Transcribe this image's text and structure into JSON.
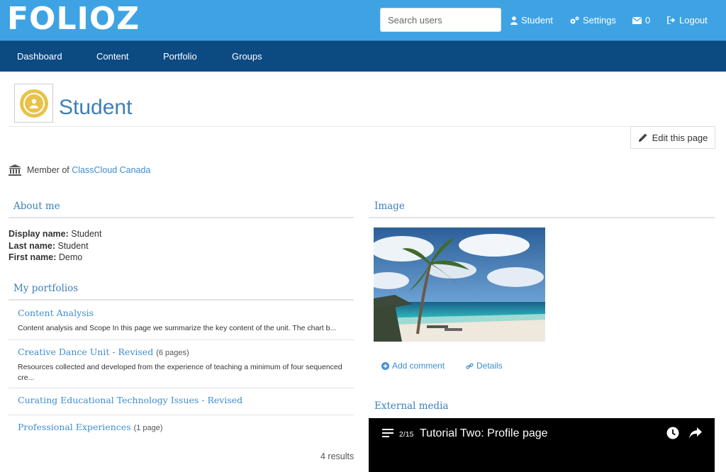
{
  "header": {
    "logo": "FOLIOZ",
    "search_placeholder": "Search users",
    "user_label": "Student",
    "settings_label": "Settings",
    "messages_count": "0",
    "logout_label": "Logout"
  },
  "nav": {
    "items": [
      {
        "label": "Dashboard"
      },
      {
        "label": "Content"
      },
      {
        "label": "Portfolio"
      },
      {
        "label": "Groups"
      }
    ]
  },
  "page": {
    "title": "Student",
    "edit_label": "Edit this page",
    "member_prefix": "Member of",
    "member_institution": "ClassCloud Canada"
  },
  "about": {
    "title": "About me",
    "fields": [
      {
        "label": "Display name:",
        "value": "Student"
      },
      {
        "label": "Last name:",
        "value": "Student"
      },
      {
        "label": "First name:",
        "value": "Demo"
      }
    ]
  },
  "portfolios": {
    "title": "My portfolios",
    "items": [
      {
        "title": "Content Analysis",
        "pages": "",
        "desc": "Content analysis and Scope In this page we summarize the key content of the unit.  The chart b..."
      },
      {
        "title": "Creative Dance Unit - Revised",
        "pages": "(6 pages)",
        "desc": "Resources collected and developed from the experience of teaching a minimum of four sequenced cre..."
      },
      {
        "title": "Curating Educational Technology Issues - Revised",
        "pages": "",
        "desc": ""
      },
      {
        "title": "Professional Experiences",
        "pages": "(1 page)",
        "desc": ""
      }
    ],
    "results": "4 results"
  },
  "image_block": {
    "title": "Image",
    "add_comment": "Add comment",
    "details": "Details"
  },
  "external_media": {
    "title": "External media",
    "playlist_count": "2/15",
    "video_title": "Tutorial Two: Profile page"
  },
  "colors": {
    "header_bg": "#3fa3e3",
    "nav_bg": "#0c4a82",
    "link": "#3d8ed0",
    "title": "#3d7fb6"
  }
}
